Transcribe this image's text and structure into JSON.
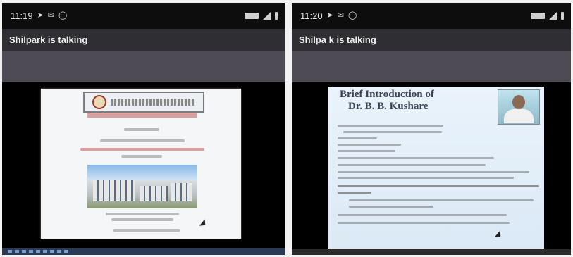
{
  "left_screen": {
    "time": "11:19",
    "status_icons": [
      "navigation-icon",
      "mail-icon",
      "whatsapp-icon"
    ],
    "header": {
      "title": "Shilpark is talking"
    }
  },
  "right_screen": {
    "time": "11:20",
    "status_icons": [
      "navigation-icon",
      "mail-icon",
      "whatsapp-icon"
    ],
    "header": {
      "title": "Shilpa k is talking"
    },
    "slide": {
      "title_line1": "Brief Introduction of",
      "title_line2": "Dr. B. B. Kushare"
    }
  },
  "colors": {
    "status_bg": "#0d0d0d",
    "header_bg": "#2f2f33",
    "band_bg": "#4e4b54",
    "slide_title": "#3c4254"
  }
}
